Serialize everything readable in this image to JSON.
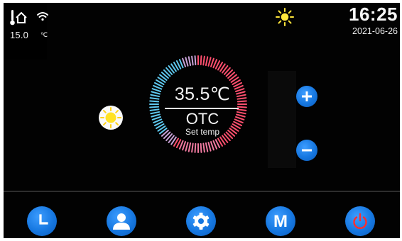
{
  "status": {
    "outdoor_temperature": "15.0",
    "temperature_unit": "℃",
    "icons": [
      "outdoor-thermometer-icon",
      "home-icon",
      "wifi-icon"
    ],
    "weather_icon": "sun-icon"
  },
  "clock": {
    "time": "16:25",
    "date": "2021-06-26"
  },
  "dial": {
    "setpoint": "35.5",
    "unit": "℃",
    "mode": "OTC",
    "caption": "Set temp",
    "mode_icon": "sun-icon"
  },
  "controls": {
    "increase_icon": "plus-icon",
    "decrease_icon": "minus-icon"
  },
  "bottom_nav": [
    {
      "icon": "clock-icon"
    },
    {
      "icon": "user-icon"
    },
    {
      "icon": "gear-icon"
    },
    {
      "label": "M",
      "icon": "mode-m-icon"
    },
    {
      "icon": "power-icon"
    }
  ],
  "colors": {
    "background": "#020202",
    "button_blue": "#1677e0",
    "dial_cold": "#5ec8ee",
    "dial_hot": "#ff4f6e",
    "power_red": "#ff2e2e",
    "sun_yellow": "#ffe63b"
  }
}
